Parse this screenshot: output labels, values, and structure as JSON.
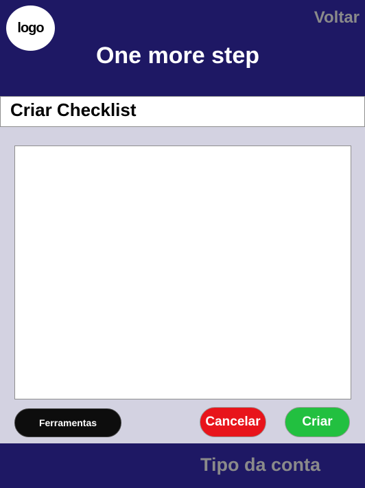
{
  "header": {
    "logo_text": "logo",
    "back_label": "Voltar",
    "title": "One more step"
  },
  "section": {
    "title": "Criar Checklist"
  },
  "editor": {
    "value": ""
  },
  "actions": {
    "tools_label": "Ferramentas",
    "cancel_label": "Cancelar",
    "create_label": "Criar"
  },
  "footer": {
    "account_type_label": "Tipo da conta"
  },
  "colors": {
    "header_bg": "#1e1864",
    "page_bg": "#d3d2e1",
    "cancel": "#e8141b",
    "create": "#22c040",
    "tools": "#0d0d0d"
  }
}
